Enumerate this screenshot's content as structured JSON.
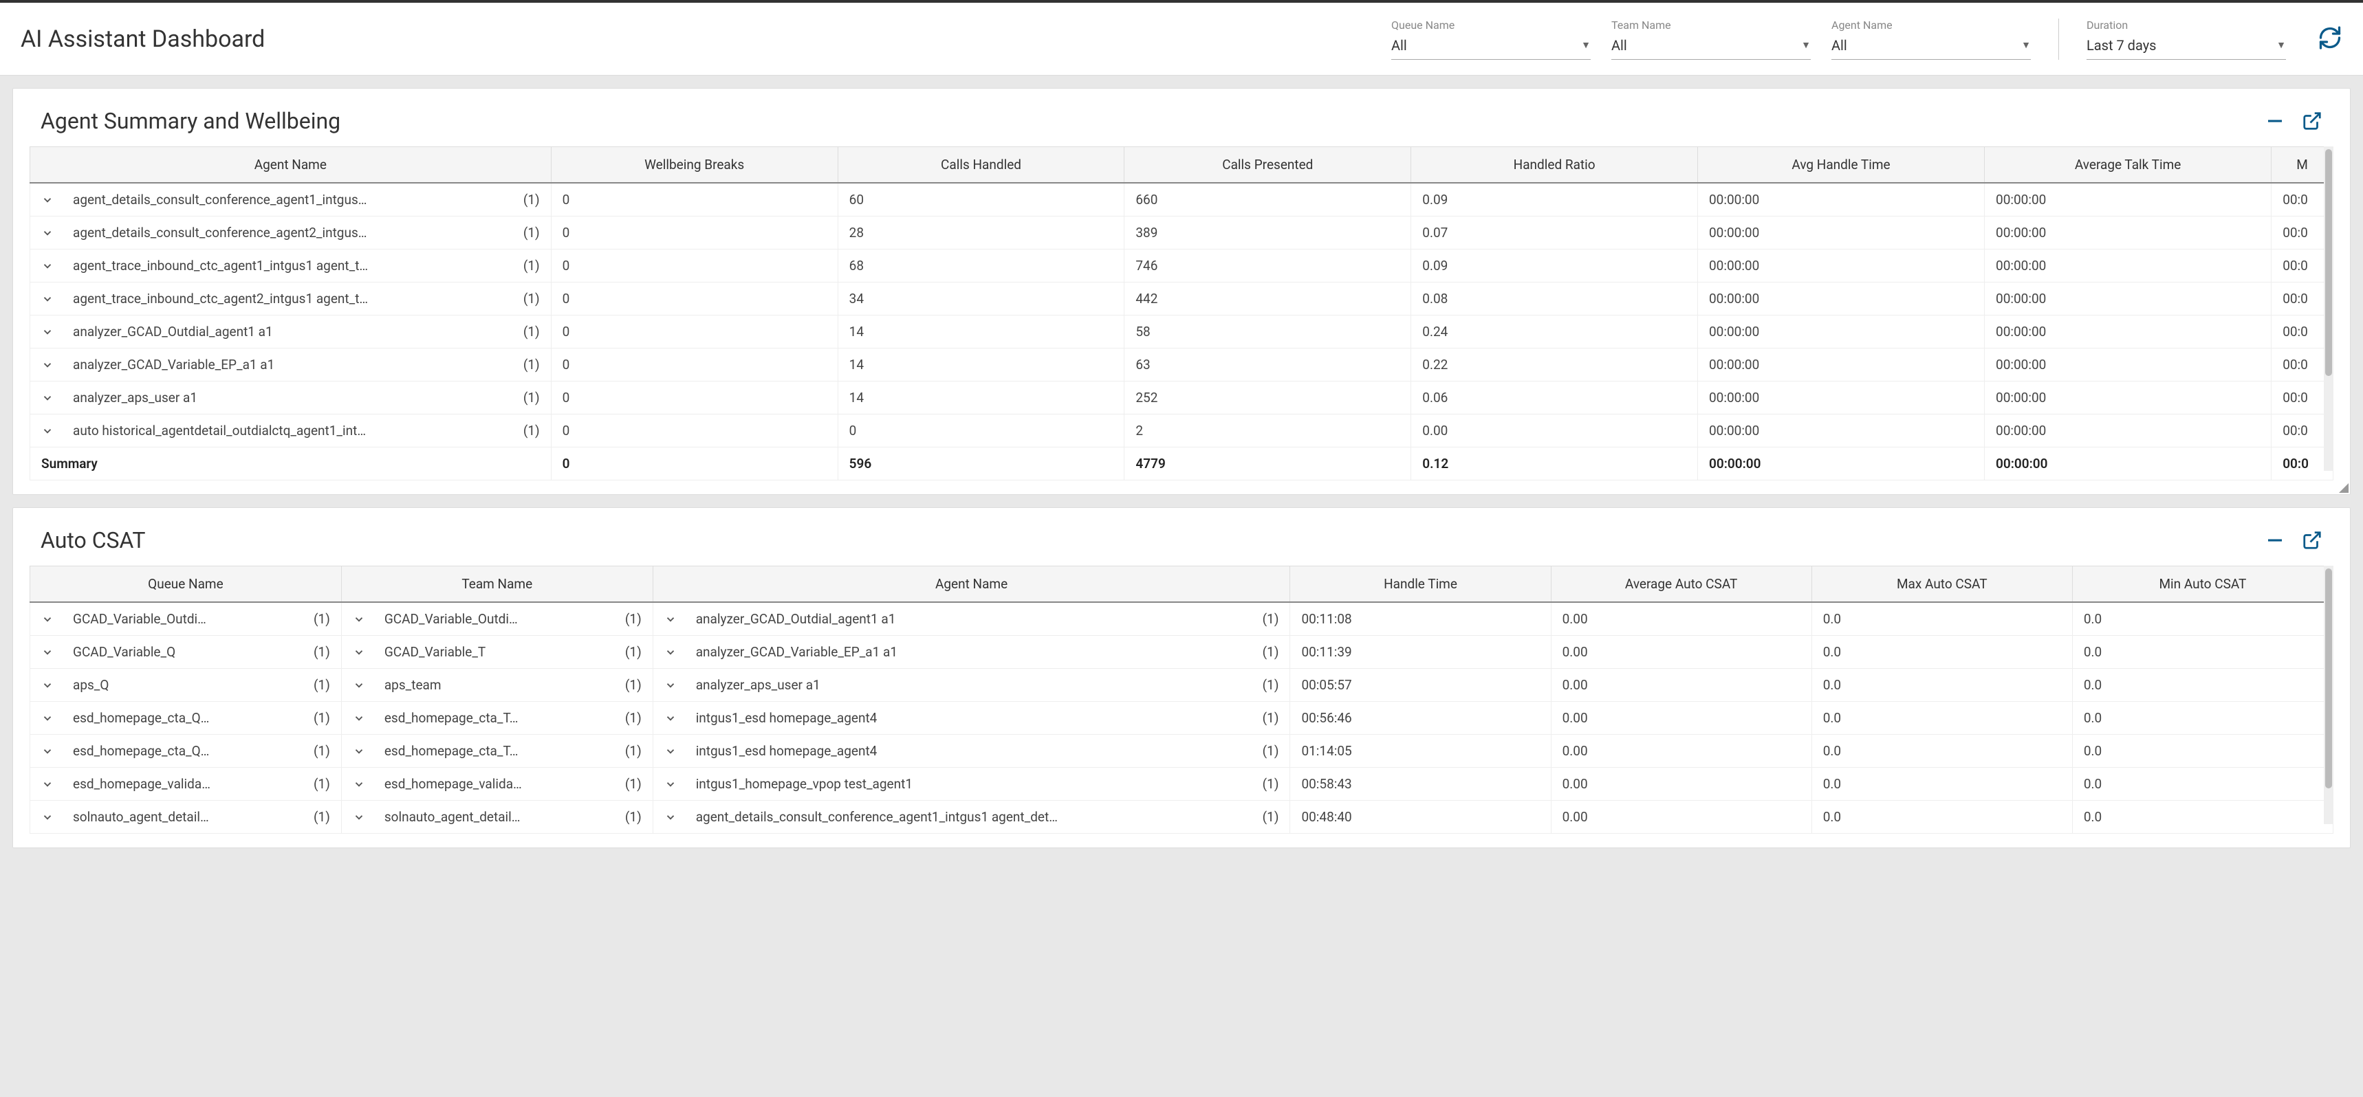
{
  "header": {
    "title": "AI Assistant Dashboard",
    "filters": {
      "queue": {
        "label": "Queue Name",
        "value": "All"
      },
      "team": {
        "label": "Team Name",
        "value": "All"
      },
      "agent": {
        "label": "Agent Name",
        "value": "All"
      },
      "duration": {
        "label": "Duration",
        "value": "Last 7 days"
      }
    }
  },
  "panel1": {
    "title": "Agent Summary and Wellbeing",
    "columns": [
      "Agent Name",
      "Wellbeing Breaks",
      "Calls Handled",
      "Calls Presented",
      "Handled Ratio",
      "Avg Handle Time",
      "Average Talk Time",
      "M"
    ],
    "rows": [
      {
        "name": "agent_details_consult_conference_agent1_intgus…",
        "count": "(1)",
        "wb": "0",
        "ch": "60",
        "cp": "660",
        "hr": "0.09",
        "aht": "00:00:00",
        "att": "00:00:00",
        "last": "00:0"
      },
      {
        "name": "agent_details_consult_conference_agent2_intgus…",
        "count": "(1)",
        "wb": "0",
        "ch": "28",
        "cp": "389",
        "hr": "0.07",
        "aht": "00:00:00",
        "att": "00:00:00",
        "last": "00:0"
      },
      {
        "name": "agent_trace_inbound_ctc_agent1_intgus1 agent_t…",
        "count": "(1)",
        "wb": "0",
        "ch": "68",
        "cp": "746",
        "hr": "0.09",
        "aht": "00:00:00",
        "att": "00:00:00",
        "last": "00:0"
      },
      {
        "name": "agent_trace_inbound_ctc_agent2_intgus1 agent_t…",
        "count": "(1)",
        "wb": "0",
        "ch": "34",
        "cp": "442",
        "hr": "0.08",
        "aht": "00:00:00",
        "att": "00:00:00",
        "last": "00:0"
      },
      {
        "name": "analyzer_GCAD_Outdial_agent1 a1",
        "count": "(1)",
        "wb": "0",
        "ch": "14",
        "cp": "58",
        "hr": "0.24",
        "aht": "00:00:00",
        "att": "00:00:00",
        "last": "00:0"
      },
      {
        "name": "analyzer_GCAD_Variable_EP_a1 a1",
        "count": "(1)",
        "wb": "0",
        "ch": "14",
        "cp": "63",
        "hr": "0.22",
        "aht": "00:00:00",
        "att": "00:00:00",
        "last": "00:0"
      },
      {
        "name": "analyzer_aps_user a1",
        "count": "(1)",
        "wb": "0",
        "ch": "14",
        "cp": "252",
        "hr": "0.06",
        "aht": "00:00:00",
        "att": "00:00:00",
        "last": "00:0"
      },
      {
        "name": "auto historical_agentdetail_outdialctq_agent1_int…",
        "count": "(1)",
        "wb": "0",
        "ch": "0",
        "cp": "2",
        "hr": "0.00",
        "aht": "00:00:00",
        "att": "00:00:00",
        "last": "00:0"
      }
    ],
    "summary": {
      "label": "Summary",
      "wb": "0",
      "ch": "596",
      "cp": "4779",
      "hr": "0.12",
      "aht": "00:00:00",
      "att": "00:00:00",
      "last": "00:0"
    }
  },
  "panel2": {
    "title": "Auto CSAT",
    "columns": [
      "Queue Name",
      "Team Name",
      "Agent Name",
      "Handle Time",
      "Average Auto CSAT",
      "Max Auto CSAT",
      "Min Auto CSAT"
    ],
    "rows": [
      {
        "queue": "GCAD_Variable_Outdi…",
        "qc": "(1)",
        "team": "GCAD_Variable_Outdi…",
        "tc": "(1)",
        "agent": "analyzer_GCAD_Outdial_agent1 a1",
        "ac": "(1)",
        "ht": "00:11:08",
        "avg": "0.00",
        "max": "0.0",
        "min": "0.0"
      },
      {
        "queue": "GCAD_Variable_Q",
        "qc": "(1)",
        "team": "GCAD_Variable_T",
        "tc": "(1)",
        "agent": "analyzer_GCAD_Variable_EP_a1 a1",
        "ac": "(1)",
        "ht": "00:11:39",
        "avg": "0.00",
        "max": "0.0",
        "min": "0.0"
      },
      {
        "queue": "aps_Q",
        "qc": "(1)",
        "team": "aps_team",
        "tc": "(1)",
        "agent": "analyzer_aps_user a1",
        "ac": "(1)",
        "ht": "00:05:57",
        "avg": "0.00",
        "max": "0.0",
        "min": "0.0"
      },
      {
        "queue": "esd_homepage_cta_Q…",
        "qc": "(1)",
        "team": "esd_homepage_cta_T…",
        "tc": "(1)",
        "agent": "intgus1_esd homepage_agent4",
        "ac": "(1)",
        "ht": "00:56:46",
        "avg": "0.00",
        "max": "0.0",
        "min": "0.0"
      },
      {
        "queue": "esd_homepage_cta_Q…",
        "qc": "(1)",
        "team": "esd_homepage_cta_T…",
        "tc": "(1)",
        "agent": "intgus1_esd homepage_agent4",
        "ac": "(1)",
        "ht": "01:14:05",
        "avg": "0.00",
        "max": "0.0",
        "min": "0.0"
      },
      {
        "queue": "esd_homepage_valida…",
        "qc": "(1)",
        "team": "esd_homepage_valida…",
        "tc": "(1)",
        "agent": "intgus1_homepage_vpop test_agent1",
        "ac": "(1)",
        "ht": "00:58:43",
        "avg": "0.00",
        "max": "0.0",
        "min": "0.0"
      },
      {
        "queue": "solnauto_agent_detail…",
        "qc": "(1)",
        "team": "solnauto_agent_detail…",
        "tc": "(1)",
        "agent": "agent_details_consult_conference_agent1_intgus1 agent_det…",
        "ac": "(1)",
        "ht": "00:48:40",
        "avg": "0.00",
        "max": "0.0",
        "min": "0.0"
      }
    ]
  }
}
